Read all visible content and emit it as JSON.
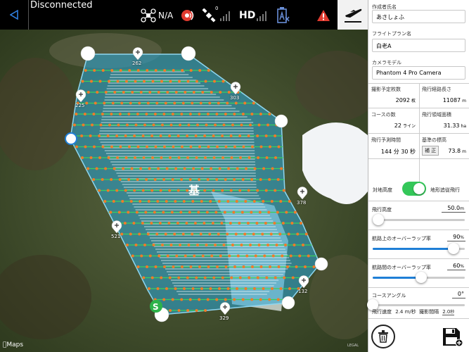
{
  "topbar": {
    "status": "Disconnected",
    "aircraft_value": "N/A",
    "satellite_count": "0",
    "hd_label": "HD",
    "back_icon": "back-triangle-icon",
    "takeoff_icon": "takeoff-icon"
  },
  "map": {
    "maps_logo": "Maps",
    "center_label": "基",
    "start_label": "S",
    "legal": "LEGAL",
    "waypoints": [
      "262",
      "225",
      "303",
      "378",
      "521",
      "132",
      "329"
    ]
  },
  "panel": {
    "author_label": "作成者氏名",
    "author_value": "あさしょふ",
    "plan_label": "フライトプラン名",
    "plan_value": "白老A",
    "camera_label": "カメラモデル",
    "camera_value": "Phantom 4 Pro Camera",
    "photos_label": "撮影予定枚数",
    "photos_value": "2092",
    "photos_unit": "枚",
    "route_len_label": "飛行経路長さ",
    "route_len_value": "11087",
    "route_len_unit": "m",
    "courses_label": "コースの数",
    "courses_value": "22",
    "courses_unit": "ライン",
    "area_label": "飛行領域面積",
    "area_value": "31.33",
    "area_unit": "ha",
    "time_label": "飛行予測時間",
    "time_value": "144 分 30 秒",
    "base_alt_label": "基準の標高",
    "base_alt_button": "補 正",
    "base_alt_value": "73.8",
    "base_alt_unit": "m",
    "toggle_left": "対地高度",
    "toggle_right": "地形追従飛行",
    "toggle_on": true,
    "altitude_label": "飛行高度",
    "altitude_value": "50.0",
    "altitude_unit": "m",
    "altitude_fraction": 0.06,
    "front_overlap_label": "航路上のオーバーラップ率",
    "front_overlap_value": "90",
    "front_overlap_unit": "%",
    "front_overlap_fraction": 0.88,
    "side_overlap_label": "航路間のオーバーラップ率",
    "side_overlap_value": "60",
    "side_overlap_unit": "%",
    "side_overlap_fraction": 0.53,
    "angle_label": "コースアングル",
    "angle_value": "0°",
    "angle_fraction": 0.0,
    "speed_label": "飛行速度",
    "speed_value": "2.4 m/秒",
    "interval_label": "撮影間隔",
    "interval_value": "2.0",
    "interval_unit": "秒",
    "accent_color": "#1f7fd6",
    "toggle_color": "#34c759",
    "delete_icon": "trash-icon",
    "save_icon": "save-icon"
  }
}
